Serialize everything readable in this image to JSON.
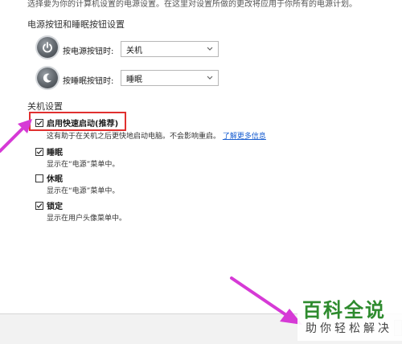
{
  "top_note": "选择要为你的计算机设置的电源设置。在这里对设置所做的更改将应用于你所有的电源计划。",
  "power_section": {
    "title": "电源按钮和睡眠按钮设置",
    "power_button": {
      "label": "按电源按钮时:",
      "value": "关机"
    },
    "sleep_button": {
      "label": "按睡眠按钮时:",
      "value": "睡眠"
    }
  },
  "shutdown_section": {
    "title": "关机设置",
    "items": [
      {
        "label": "启用快速启动(推荐)",
        "checked": true,
        "desc": "这有助于在关机之后更快地启动电脑。不会影响重启。",
        "link": "了解更多信息"
      },
      {
        "label": "睡眠",
        "checked": true,
        "desc": "显示在“电源”菜单中。"
      },
      {
        "label": "休眠",
        "checked": false,
        "desc": "显示在“电源”菜单中。"
      },
      {
        "label": "锁定",
        "checked": true,
        "desc": "显示在用户头像菜单中。"
      }
    ]
  },
  "watermark": {
    "title": "百科全说",
    "subtitle": "助你轻松解决"
  },
  "colors": {
    "highlight": "#e0302f",
    "arrow": "#d63ad6",
    "link": "#1a5fd1",
    "watermark": "#2e8b2e"
  }
}
